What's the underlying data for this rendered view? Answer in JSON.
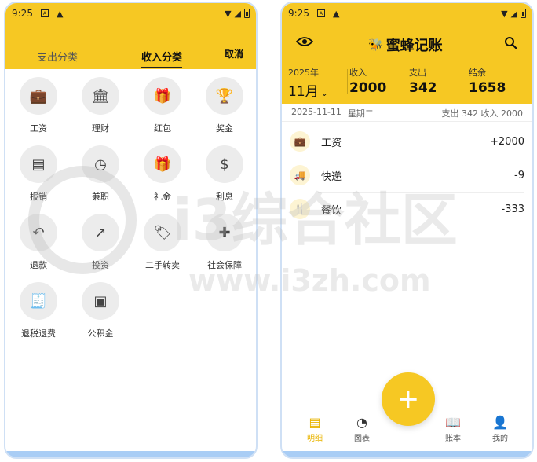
{
  "status_left": {
    "time": "9:25"
  },
  "status_right": {
    "time": "9:25"
  },
  "left_screen": {
    "tabs": {
      "expense": "支出分类",
      "income": "收入分类"
    },
    "cancel": "取消",
    "categories": [
      {
        "label": "工资",
        "icon": "briefcase-icon",
        "glyph": "💼"
      },
      {
        "label": "理财",
        "icon": "bank-icon",
        "glyph": "🏛"
      },
      {
        "label": "红包",
        "icon": "red-envelope-icon",
        "glyph": "🎁"
      },
      {
        "label": "奖金",
        "icon": "trophy-icon",
        "glyph": "🏆"
      },
      {
        "label": "报销",
        "icon": "receipt-icon",
        "glyph": "▤"
      },
      {
        "label": "兼职",
        "icon": "clock-icon",
        "glyph": "◷"
      },
      {
        "label": "礼金",
        "icon": "gift-icon",
        "glyph": "🎁"
      },
      {
        "label": "利息",
        "icon": "dollar-icon",
        "glyph": "$"
      },
      {
        "label": "退款",
        "icon": "undo-icon",
        "glyph": "↶"
      },
      {
        "label": "投资",
        "icon": "trending-up-icon",
        "glyph": "↗"
      },
      {
        "label": "二手转卖",
        "icon": "tag-icon",
        "glyph": "🏷"
      },
      {
        "label": "社会保障",
        "icon": "shield-plus-icon",
        "glyph": "✚"
      },
      {
        "label": "退税退费",
        "icon": "tax-receipt-icon",
        "glyph": "🧾"
      },
      {
        "label": "公积金",
        "icon": "wallet-icon",
        "glyph": "▣"
      }
    ]
  },
  "right_screen": {
    "app_title": "蜜蜂记账",
    "summary": {
      "year": "2025年",
      "month": "11月",
      "income_label": "收入",
      "income": "2000",
      "expense_label": "支出",
      "expense": "342",
      "balance_label": "结余",
      "balance": "1658"
    },
    "day": {
      "date": "2025-11-11",
      "weekday": "星期二",
      "totals": "支出 342   收入 2000"
    },
    "transactions": [
      {
        "name": "工资",
        "amount": "+2000",
        "icon": "briefcase-icon",
        "glyph": "💼"
      },
      {
        "name": "快递",
        "amount": "-9",
        "icon": "truck-icon",
        "glyph": "🚚"
      },
      {
        "name": "餐饮",
        "amount": "-333",
        "icon": "utensils-icon",
        "glyph": "🍴"
      }
    ],
    "nav": [
      {
        "label": "明细",
        "icon": "list-icon",
        "glyph": "▤"
      },
      {
        "label": "图表",
        "icon": "pie-chart-icon",
        "glyph": "◔"
      },
      {
        "label": "账本",
        "icon": "book-icon",
        "glyph": "📖"
      },
      {
        "label": "我的",
        "icon": "person-icon",
        "glyph": "👤"
      }
    ],
    "fab": "+"
  },
  "watermark": {
    "text": "i3综合社区",
    "url": "www.i3zh.com"
  },
  "colors": {
    "accent": "#f6c823",
    "accent_dark": "#e9b400"
  }
}
